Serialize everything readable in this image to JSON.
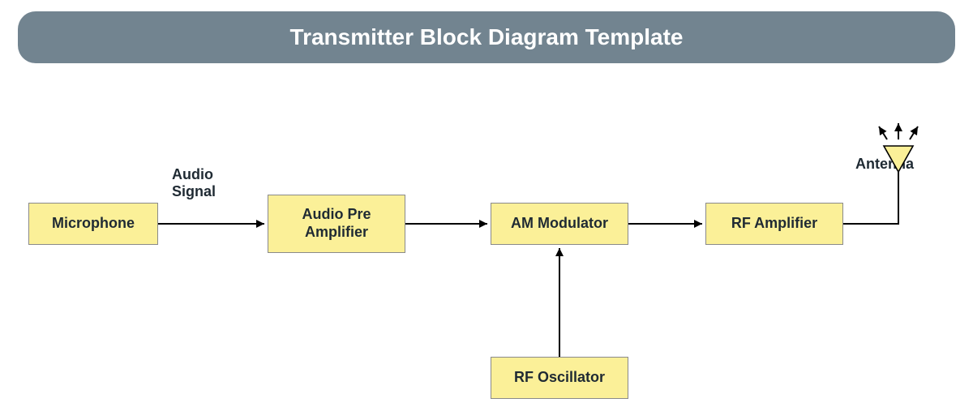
{
  "title": "Transmitter Block Diagram Template",
  "blocks": {
    "microphone": "Microphone",
    "audio_pre_amp": "Audio Pre Amplifier",
    "am_modulator": "AM Modulator",
    "rf_amplifier": "RF Amplifier",
    "rf_oscillator": "RF Oscillator"
  },
  "labels": {
    "audio_signal_line1": "Audio",
    "audio_signal_line2": "Signal",
    "antenna": "Antenna"
  },
  "colors": {
    "title_bg": "#728490",
    "block_fill": "#fbf098",
    "block_border": "#8a8a8a",
    "stroke": "#000000"
  }
}
